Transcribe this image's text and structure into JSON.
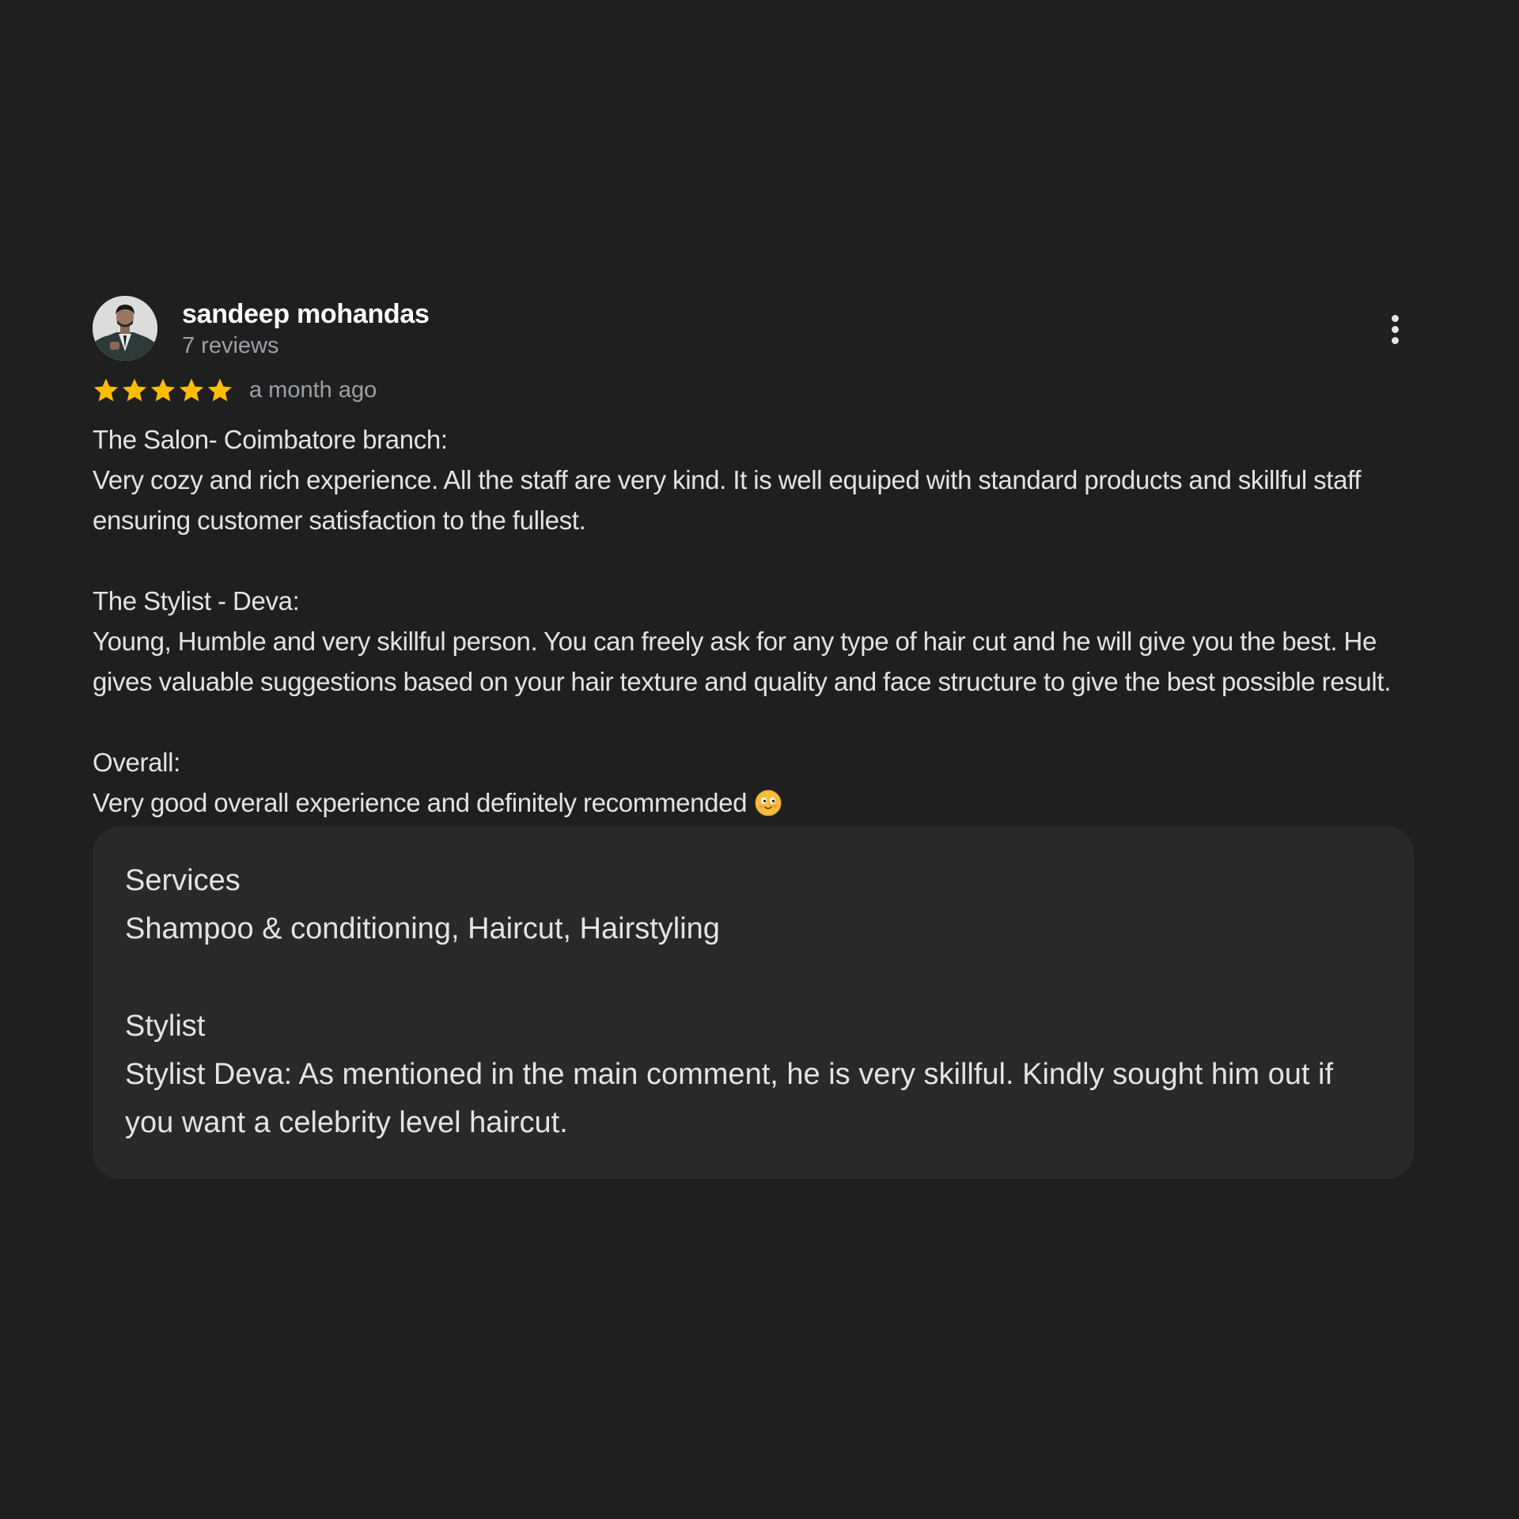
{
  "review": {
    "author": {
      "name": "sandeep mohandas",
      "reviews_count": "7 reviews"
    },
    "rating": 5,
    "rating_max": 5,
    "date": "a month ago",
    "more_icon": "more-vert-icon",
    "text": {
      "salon_heading": "The Salon- Coimbatore branch:",
      "salon_body": "Very cozy and rich experience. All the staff are very kind. It is well equiped with standard products and skillful staff ensuring customer satisfaction to the fullest.",
      "stylist_heading": "The Stylist - Deva:",
      "stylist_body": "Young, Humble and very skillful person. You can freely ask for any type of hair cut and he will give you the best. He gives valuable suggestions based on your hair texture and quality and face structure to give the best possible result.",
      "overall_heading": "Overall:",
      "overall_body": "Very good overall experience and definitely recommended"
    },
    "details": {
      "services_label": "Services",
      "services_value": "Shampoo & conditioning, Haircut, Hairstyling",
      "stylist_label": "Stylist",
      "stylist_value": "Stylist Deva: As mentioned in the main comment, he is very skillful. Kindly sought him out if you want a celebrity level haircut."
    }
  },
  "colors": {
    "background": "#1f1f1f",
    "star": "#fbbc04",
    "details_box": "#28292b",
    "secondary_text": "#9aa0a6"
  }
}
